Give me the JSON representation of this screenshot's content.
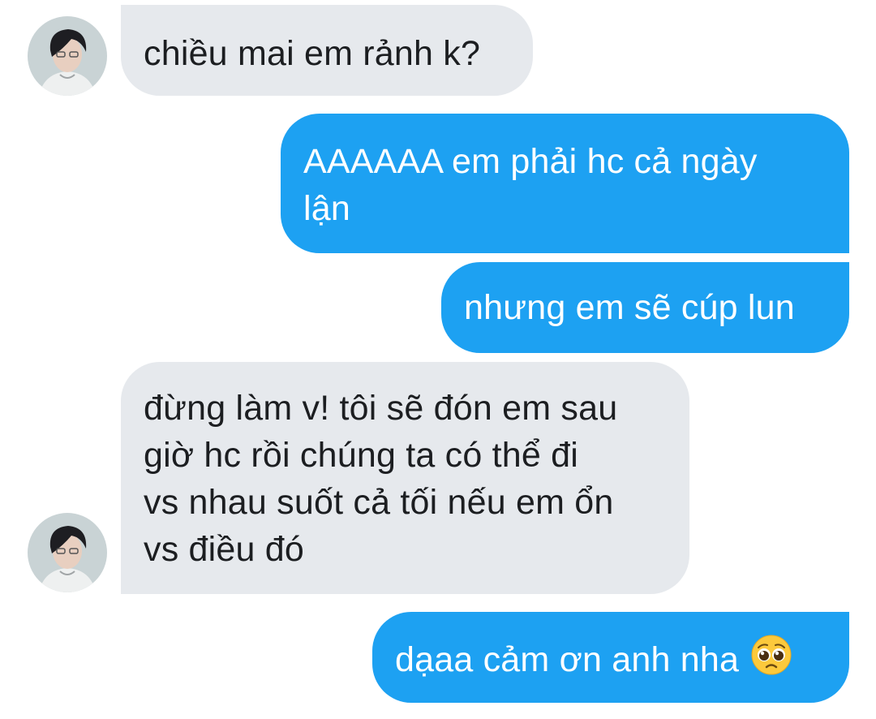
{
  "conversation": {
    "messages": [
      {
        "sender": "contact",
        "text": "chiều mai em rảnh k?"
      },
      {
        "sender": "me",
        "lines": [
          "AAAAAA em phải hc cả ngày",
          "lận"
        ]
      },
      {
        "sender": "me",
        "text": "nhưng em sẽ cúp lun"
      },
      {
        "sender": "contact",
        "lines": [
          "đừng làm v! tôi sẽ đón em sau",
          "giờ hc rồi chúng ta có thể đi",
          "vs nhau suốt cả tối nếu em ổn",
          "vs điều đó"
        ]
      },
      {
        "sender": "me",
        "text": "dạaa cảm ơn anh nha",
        "emoji": "pleading-face"
      }
    ]
  },
  "colors": {
    "incoming_bubble": "#e6e9ed",
    "outgoing_bubble": "#1da1f2",
    "background": "#ffffff"
  }
}
